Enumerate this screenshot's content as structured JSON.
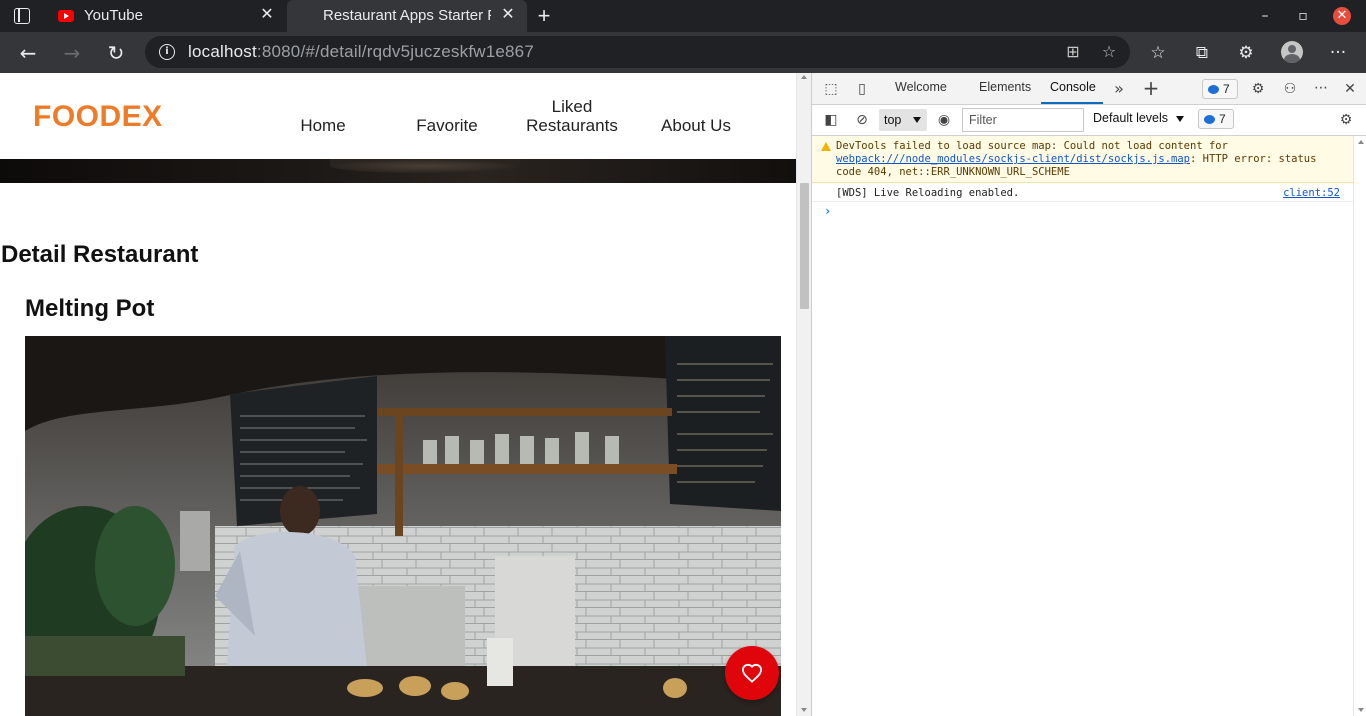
{
  "browser": {
    "tabs": [
      {
        "title": "YouTube",
        "icon": "youtube-icon",
        "active": false
      },
      {
        "title": "Restaurant Apps Starter P",
        "icon": "",
        "active": true
      }
    ],
    "new_tab_label": "+",
    "close_glyph": "✕",
    "window_controls": {
      "minimize": "–",
      "maximize": "▫",
      "close": "✕"
    },
    "url": {
      "host": "localhost",
      "rest": ":8080/#/detail/rqdv5juczeskfw1e867"
    },
    "icons": [
      "back-icon",
      "forward-icon",
      "refresh-icon",
      "site-info-icon",
      "app-available-icon",
      "add-favorite-icon",
      "favorites-icon",
      "collections-icon",
      "extensions-icon",
      "profile-icon",
      "more-icon"
    ]
  },
  "app": {
    "logo": "FOODEX",
    "brand_color": "#f07b26",
    "nav": [
      {
        "line1": "",
        "line2": "Home"
      },
      {
        "line1": "",
        "line2": "Favorite"
      },
      {
        "line1": "Liked",
        "line2": "Restaurants"
      },
      {
        "line1": "",
        "line2": "About Us"
      }
    ],
    "section_title": "Detail Restaurant",
    "restaurant_name": "Melting Pot",
    "like_button_color": "#e0050b"
  },
  "devtools": {
    "tabs": [
      "Welcome",
      "Elements",
      "Console"
    ],
    "active_tab": "Console",
    "issues_count": "7",
    "context": "top",
    "filter_placeholder": "Filter",
    "levels": "Default levels",
    "filter_issues_count": "7",
    "messages": [
      {
        "level": "warning",
        "prefix": "DevTools failed to load source map: Could not load content for ",
        "link": "webpack:///node_modules/sockjs-client/dist/sockjs.js.map",
        "suffix": ": HTTP error: status code 404, net::ERR_UNKNOWN_URL_SCHEME"
      },
      {
        "level": "info",
        "text": "[WDS] Live Reloading enabled.",
        "source": "client:52"
      }
    ],
    "prompt": "›"
  }
}
